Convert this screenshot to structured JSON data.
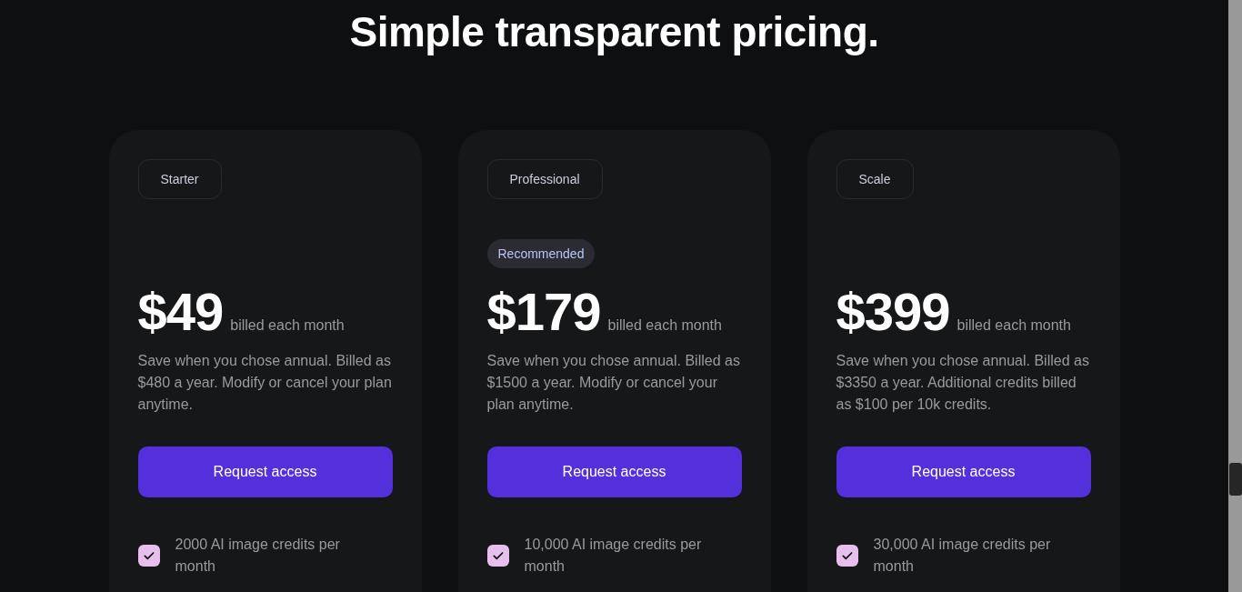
{
  "title": "Simple transparent pricing.",
  "plans": [
    {
      "name": "Starter",
      "recommended": false,
      "price": "$49",
      "period": "billed each month",
      "description": "Save when you chose annual. Billed as $480 a year. Modify or cancel your plan anytime.",
      "button": "Request access",
      "features": [
        {
          "text": "2000 AI image credits per month",
          "checked": true
        }
      ]
    },
    {
      "name": "Professional",
      "recommended": true,
      "badge": "Recommended",
      "price": "$179",
      "period": "billed each month",
      "description": "Save when you chose annual. Billed as $1500 a year. Modify or cancel your plan anytime.",
      "button": "Request access",
      "features": [
        {
          "text": "10,000 AI image credits per month",
          "checked": true
        }
      ]
    },
    {
      "name": "Scale",
      "recommended": false,
      "price": "$399",
      "period": "billed each month",
      "description": "Save when you chose annual. Billed as $3350 a year. Additional credits billed as $100 per 10k credits.",
      "button": "Request access",
      "features": [
        {
          "text": "30,000 AI image credits per month",
          "checked": true
        }
      ]
    }
  ]
}
